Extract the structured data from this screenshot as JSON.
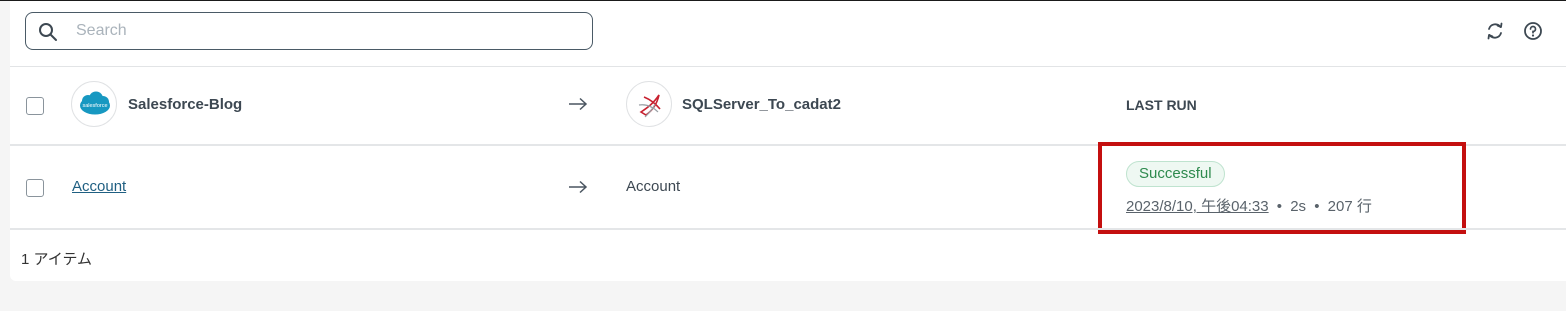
{
  "search": {
    "placeholder": "Search",
    "value": ""
  },
  "toolbar": {
    "refresh_icon": "refresh-icon",
    "help_icon": "help-icon"
  },
  "header_row": {
    "source": {
      "name": "Salesforce-Blog",
      "logo": "salesforce-logo",
      "logo_text": "salesforce"
    },
    "destination": {
      "name": "SQLServer_To_cadat2",
      "logo": "sqlserver-logo"
    },
    "last_run_label": "LAST RUN"
  },
  "rows": [
    {
      "source_object": "Account",
      "destination_object": "Account",
      "status": "Successful",
      "run_date": "2023/8/10, 午後04:33",
      "duration": "2s",
      "rows_count": "207 行",
      "separator": "•"
    }
  ],
  "footer": {
    "item_count": "1 アイテム"
  },
  "colors": {
    "accent_link": "#1f5f82",
    "success_text": "#2e8a4e",
    "success_bg": "#eef8f2",
    "highlight_border": "#c40f0f",
    "salesforce_blue": "#1798c1",
    "sqlserver_red": "#c8202f"
  }
}
